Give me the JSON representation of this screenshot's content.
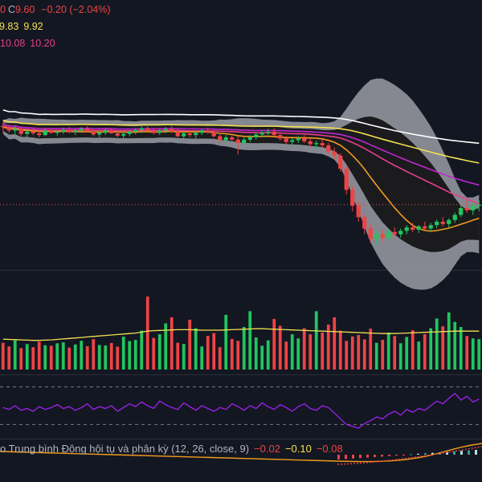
{
  "colors": {
    "background": "#131722",
    "up": "#22c55e",
    "down": "#ef4444",
    "bb_fill": "#9a9ca3",
    "bb_inner": "#1b1b1e",
    "ma_white": "#ffffff",
    "ma_yellow": "#f5e050",
    "ma_orange": "#f29b1d",
    "ma_pink": "#e83e8c",
    "ma_magenta": "#c026d3",
    "volume_ma": "#f5e050",
    "rsi": "#a020f0",
    "macd_line": "#f29b1d",
    "signal_line": "#ef4444",
    "hist_up": "#26a69a",
    "hist_up_light": "#b2dfdb"
  },
  "legend": {
    "ohlc_row": {
      "tail": "0",
      "c_label": "C",
      "close": "9.60",
      "change": "−0.20 (−2.04%)",
      "color": "#ef4444"
    },
    "ma_row1": {
      "v1": "9.83",
      "v2": "9.92",
      "color": "#f5e050"
    },
    "ma_row2": {
      "v1": "10.08",
      "v2": "10.20",
      "color": "#e83e8c"
    }
  },
  "macd_legend": {
    "title": "o Trung bình Động hội tụ và phân kỳ (12, 26, close, 9)",
    "hist": "−0.02",
    "macd": "−0.10",
    "signal": "−0.08"
  },
  "chart_data": {
    "type": "candlestick",
    "description_series": [
      "price_candles",
      "volume",
      "rsi",
      "macd"
    ],
    "price_candles": [
      [
        11.6,
        11.65,
        11.5,
        11.58
      ],
      [
        11.58,
        11.62,
        11.48,
        11.52
      ],
      [
        11.52,
        11.6,
        11.45,
        11.55
      ],
      [
        11.55,
        11.58,
        11.42,
        11.46
      ],
      [
        11.46,
        11.54,
        11.4,
        11.5
      ],
      [
        11.5,
        11.56,
        11.44,
        11.47
      ],
      [
        11.47,
        11.52,
        11.4,
        11.44
      ],
      [
        11.44,
        11.55,
        11.42,
        11.52
      ],
      [
        11.52,
        11.56,
        11.46,
        11.48
      ],
      [
        11.48,
        11.53,
        11.43,
        11.5
      ],
      [
        11.5,
        11.57,
        11.46,
        11.53
      ],
      [
        11.53,
        11.58,
        11.47,
        11.49
      ],
      [
        11.49,
        11.55,
        11.44,
        11.52
      ],
      [
        11.52,
        11.58,
        11.48,
        11.55
      ],
      [
        11.55,
        11.6,
        11.49,
        11.5
      ],
      [
        11.5,
        11.54,
        11.42,
        11.45
      ],
      [
        11.45,
        11.52,
        11.4,
        11.48
      ],
      [
        11.48,
        11.55,
        11.44,
        11.52
      ],
      [
        11.52,
        11.56,
        11.46,
        11.47
      ],
      [
        11.47,
        11.51,
        11.4,
        11.43
      ],
      [
        11.43,
        11.5,
        11.38,
        11.46
      ],
      [
        11.46,
        11.53,
        11.42,
        11.5
      ],
      [
        11.5,
        11.56,
        11.45,
        11.53
      ],
      [
        11.53,
        11.6,
        11.48,
        11.56
      ],
      [
        11.56,
        11.62,
        11.5,
        11.52
      ],
      [
        11.52,
        11.56,
        11.45,
        11.48
      ],
      [
        11.48,
        11.55,
        11.44,
        11.52
      ],
      [
        11.52,
        11.58,
        11.47,
        11.55
      ],
      [
        11.55,
        11.6,
        11.48,
        11.5
      ],
      [
        11.5,
        11.55,
        11.4,
        11.42
      ],
      [
        11.42,
        11.5,
        11.36,
        11.47
      ],
      [
        11.47,
        11.52,
        11.4,
        11.44
      ],
      [
        11.44,
        11.5,
        11.38,
        11.48
      ],
      [
        11.48,
        11.55,
        11.44,
        11.52
      ],
      [
        11.52,
        11.57,
        11.46,
        11.49
      ],
      [
        11.49,
        11.53,
        11.4,
        11.42
      ],
      [
        11.42,
        11.48,
        11.3,
        11.35
      ],
      [
        11.35,
        11.44,
        11.3,
        11.4
      ],
      [
        11.4,
        11.46,
        11.34,
        11.36
      ],
      [
        11.36,
        11.42,
        11.1,
        11.3
      ],
      [
        11.3,
        11.4,
        11.25,
        11.36
      ],
      [
        11.36,
        11.44,
        11.32,
        11.4
      ],
      [
        11.4,
        11.48,
        11.36,
        11.45
      ],
      [
        11.45,
        11.52,
        11.4,
        11.48
      ],
      [
        11.48,
        11.55,
        11.44,
        11.5
      ],
      [
        11.5,
        11.56,
        11.42,
        11.44
      ],
      [
        11.44,
        11.48,
        11.34,
        11.38
      ],
      [
        11.38,
        11.42,
        11.28,
        11.32
      ],
      [
        11.32,
        11.38,
        11.25,
        11.35
      ],
      [
        11.35,
        11.42,
        11.3,
        11.38
      ],
      [
        11.38,
        11.44,
        11.3,
        11.33
      ],
      [
        11.33,
        11.38,
        11.24,
        11.28
      ],
      [
        11.28,
        11.34,
        11.2,
        11.3
      ],
      [
        11.3,
        11.36,
        11.22,
        11.26
      ],
      [
        11.26,
        11.3,
        11.1,
        11.15
      ],
      [
        11.15,
        11.22,
        11.02,
        11.08
      ],
      [
        11.08,
        11.12,
        10.8,
        10.85
      ],
      [
        10.85,
        10.9,
        10.4,
        10.48
      ],
      [
        10.48,
        10.55,
        10.1,
        10.2
      ],
      [
        10.2,
        10.28,
        9.92,
        10.0
      ],
      [
        10.0,
        10.05,
        9.7,
        9.8
      ],
      [
        9.8,
        9.88,
        9.55,
        9.62
      ],
      [
        9.62,
        9.75,
        9.52,
        9.7
      ],
      [
        9.7,
        9.78,
        9.58,
        9.64
      ],
      [
        9.64,
        9.78,
        9.6,
        9.74
      ],
      [
        9.74,
        9.82,
        9.66,
        9.7
      ],
      [
        9.7,
        9.8,
        9.64,
        9.76
      ],
      [
        9.76,
        9.86,
        9.7,
        9.82
      ],
      [
        9.82,
        9.9,
        9.74,
        9.78
      ],
      [
        9.78,
        9.86,
        9.72,
        9.84
      ],
      [
        9.84,
        9.92,
        9.78,
        9.8
      ],
      [
        9.8,
        9.9,
        9.74,
        9.86
      ],
      [
        9.86,
        9.96,
        9.8,
        9.92
      ],
      [
        9.92,
        10.0,
        9.84,
        9.88
      ],
      [
        9.88,
        9.98,
        9.82,
        9.95
      ],
      [
        9.95,
        10.08,
        9.9,
        10.04
      ],
      [
        10.04,
        10.2,
        10.0,
        10.16
      ],
      [
        10.16,
        10.3,
        10.08,
        10.12
      ],
      [
        10.12,
        10.25,
        10.04,
        10.2
      ],
      [
        10.2,
        10.3,
        10.1,
        10.22
      ]
    ],
    "price_ylim": [
      9.3,
      12.4
    ],
    "volume": [
      110,
      95,
      120,
      88,
      105,
      92,
      115,
      100,
      98,
      108,
      112,
      90,
      103,
      118,
      96,
      125,
      101,
      99,
      109,
      94,
      135,
      117,
      122,
      160,
      300,
      130,
      145,
      190,
      215,
      110,
      105,
      205,
      170,
      95,
      138,
      150,
      92,
      225,
      126,
      118,
      175,
      240,
      132,
      98,
      120,
      208,
      180,
      115,
      145,
      128,
      170,
      145,
      240,
      152,
      185,
      215,
      160,
      118,
      136,
      142,
      124,
      168,
      110,
      122,
      152,
      138,
      108,
      134,
      162,
      115,
      145,
      170,
      210,
      178,
      235,
      196,
      175,
      138,
      128,
      125
    ],
    "volume_ma": [
      125,
      124,
      123,
      122,
      121,
      120,
      120,
      121,
      122,
      124,
      126,
      128,
      130,
      132,
      134,
      136,
      138,
      140,
      142,
      144,
      146,
      148,
      150,
      154,
      158,
      160,
      161,
      162,
      163,
      164,
      164,
      164,
      163,
      162,
      162,
      162,
      162,
      163,
      164,
      165,
      166,
      167,
      168,
      168,
      167,
      166,
      165,
      164,
      163,
      162,
      161,
      160,
      159,
      158,
      157,
      156,
      155,
      154,
      153,
      152,
      151,
      150,
      149,
      148,
      148,
      148,
      149,
      150,
      151,
      152,
      153,
      154,
      155,
      156,
      157,
      158,
      158,
      158,
      158,
      158
    ],
    "volume_ylim": [
      0,
      380
    ],
    "rsi": [
      48,
      46,
      50,
      45,
      47,
      44,
      49,
      46,
      48,
      51,
      47,
      49,
      45,
      48,
      52,
      46,
      49,
      47,
      50,
      44,
      48,
      52,
      49,
      54,
      50,
      47,
      55,
      51,
      48,
      46,
      53,
      49,
      45,
      50,
      47,
      44,
      48,
      46,
      52,
      49,
      45,
      50,
      47,
      53,
      49,
      46,
      51,
      48,
      44,
      49,
      52,
      47,
      45,
      50,
      48,
      42,
      36,
      30,
      28,
      26,
      31,
      34,
      38,
      36,
      41,
      44,
      40,
      46,
      43,
      47,
      45,
      50,
      55,
      52,
      58,
      63,
      56,
      60,
      54,
      57
    ],
    "rsi_ylim": [
      20,
      80
    ],
    "macd_hist": [
      -0.1,
      -0.09,
      -0.08,
      -0.07,
      -0.06,
      -0.05,
      -0.04,
      -0.03,
      -0.02,
      -0.01,
      0.01,
      0.02,
      0.03,
      0.04,
      0.05,
      0.06,
      0.07,
      0.08,
      0.09,
      0.1
    ]
  }
}
